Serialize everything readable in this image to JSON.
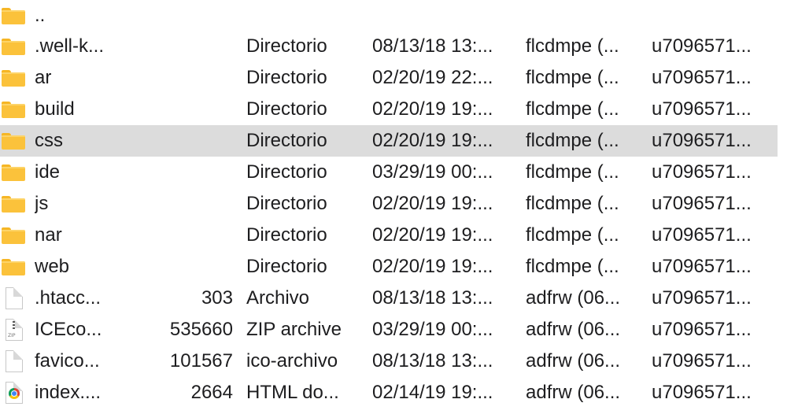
{
  "files": [
    {
      "name": "..",
      "size": "",
      "type": "",
      "modified": "",
      "owner": "",
      "group": "",
      "icon": "folder-icon"
    },
    {
      "name": ".well-k...",
      "size": "",
      "type": "Directorio",
      "modified": "08/13/18 13:...",
      "owner": "flcdmpe (...",
      "group": "u7096571...",
      "icon": "folder-icon"
    },
    {
      "name": "ar",
      "size": "",
      "type": "Directorio",
      "modified": "02/20/19 22:...",
      "owner": "flcdmpe (...",
      "group": "u7096571...",
      "icon": "folder-icon"
    },
    {
      "name": "build",
      "size": "",
      "type": "Directorio",
      "modified": "02/20/19 19:...",
      "owner": "flcdmpe (...",
      "group": "u7096571...",
      "icon": "folder-icon"
    },
    {
      "name": "css",
      "size": "",
      "type": "Directorio",
      "modified": "02/20/19 19:...",
      "owner": "flcdmpe (...",
      "group": "u7096571...",
      "icon": "folder-icon",
      "selected": true
    },
    {
      "name": "ide",
      "size": "",
      "type": "Directorio",
      "modified": "03/29/19 00:...",
      "owner": "flcdmpe (...",
      "group": "u7096571...",
      "icon": "folder-icon"
    },
    {
      "name": "js",
      "size": "",
      "type": "Directorio",
      "modified": "02/20/19 19:...",
      "owner": "flcdmpe (...",
      "group": "u7096571...",
      "icon": "folder-icon"
    },
    {
      "name": "nar",
      "size": "",
      "type": "Directorio",
      "modified": "02/20/19 19:...",
      "owner": "flcdmpe (...",
      "group": "u7096571...",
      "icon": "folder-icon"
    },
    {
      "name": "web",
      "size": "",
      "type": "Directorio",
      "modified": "02/20/19 19:...",
      "owner": "flcdmpe (...",
      "group": "u7096571...",
      "icon": "folder-icon"
    },
    {
      "name": ".htacc...",
      "size": "303",
      "type": "Archivo",
      "modified": "08/13/18 13:...",
      "owner": "adfrw (06...",
      "group": "u7096571...",
      "icon": "document-icon"
    },
    {
      "name": "ICEco...",
      "size": "535660",
      "type": "ZIP archive",
      "modified": "03/29/19 00:...",
      "owner": "adfrw (06...",
      "group": "u7096571...",
      "icon": "zip-file-icon",
      "icon_text": "ZIP"
    },
    {
      "name": "favico...",
      "size": "101567",
      "type": "ico-archivo",
      "modified": "08/13/18 13:...",
      "owner": "adfrw (06...",
      "group": "u7096571...",
      "icon": "document-icon"
    },
    {
      "name": "index....",
      "size": "2664",
      "type": "HTML do...",
      "modified": "02/14/19 19:...",
      "owner": "adfrw (06...",
      "group": "u7096571...",
      "icon": "chrome-html-file-icon"
    }
  ],
  "colors": {
    "selected_row": "#dcdcdc",
    "folder": "#fbc23b",
    "text": "#1d1d1f"
  }
}
